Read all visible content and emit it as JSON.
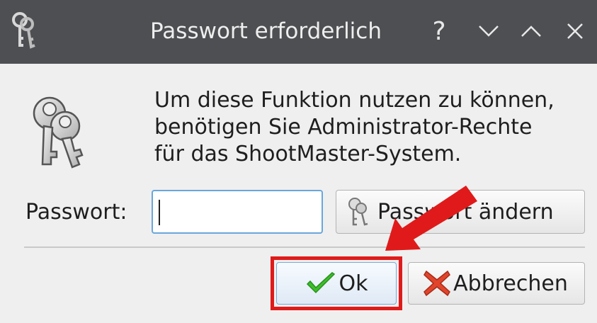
{
  "window": {
    "title": "Passwort erforderlich",
    "controls": {
      "help": "?",
      "minimize_icon": "chevron-down-icon",
      "maximize_icon": "chevron-up-icon",
      "close_icon": "close-icon"
    }
  },
  "dialog": {
    "message_lines": [
      "Um diese Funktion nutzen zu können,",
      "benötigen Sie Administrator-Rechte",
      "für das ShootMaster-System."
    ],
    "password_label": "Passwort:",
    "password_value": "",
    "change_password_label": "Passwort ändern",
    "ok_label": "Ok",
    "cancel_label": "Abbrechen"
  },
  "annotations": {
    "highlight_color": "#e01a1a",
    "arrow_color": "#e01a1a"
  },
  "colors": {
    "titlebar": "#4d4f52",
    "input_focus_border": "#6aa6dc",
    "ok_check": "#3cbf2a",
    "cancel_x": "#e0452c"
  }
}
